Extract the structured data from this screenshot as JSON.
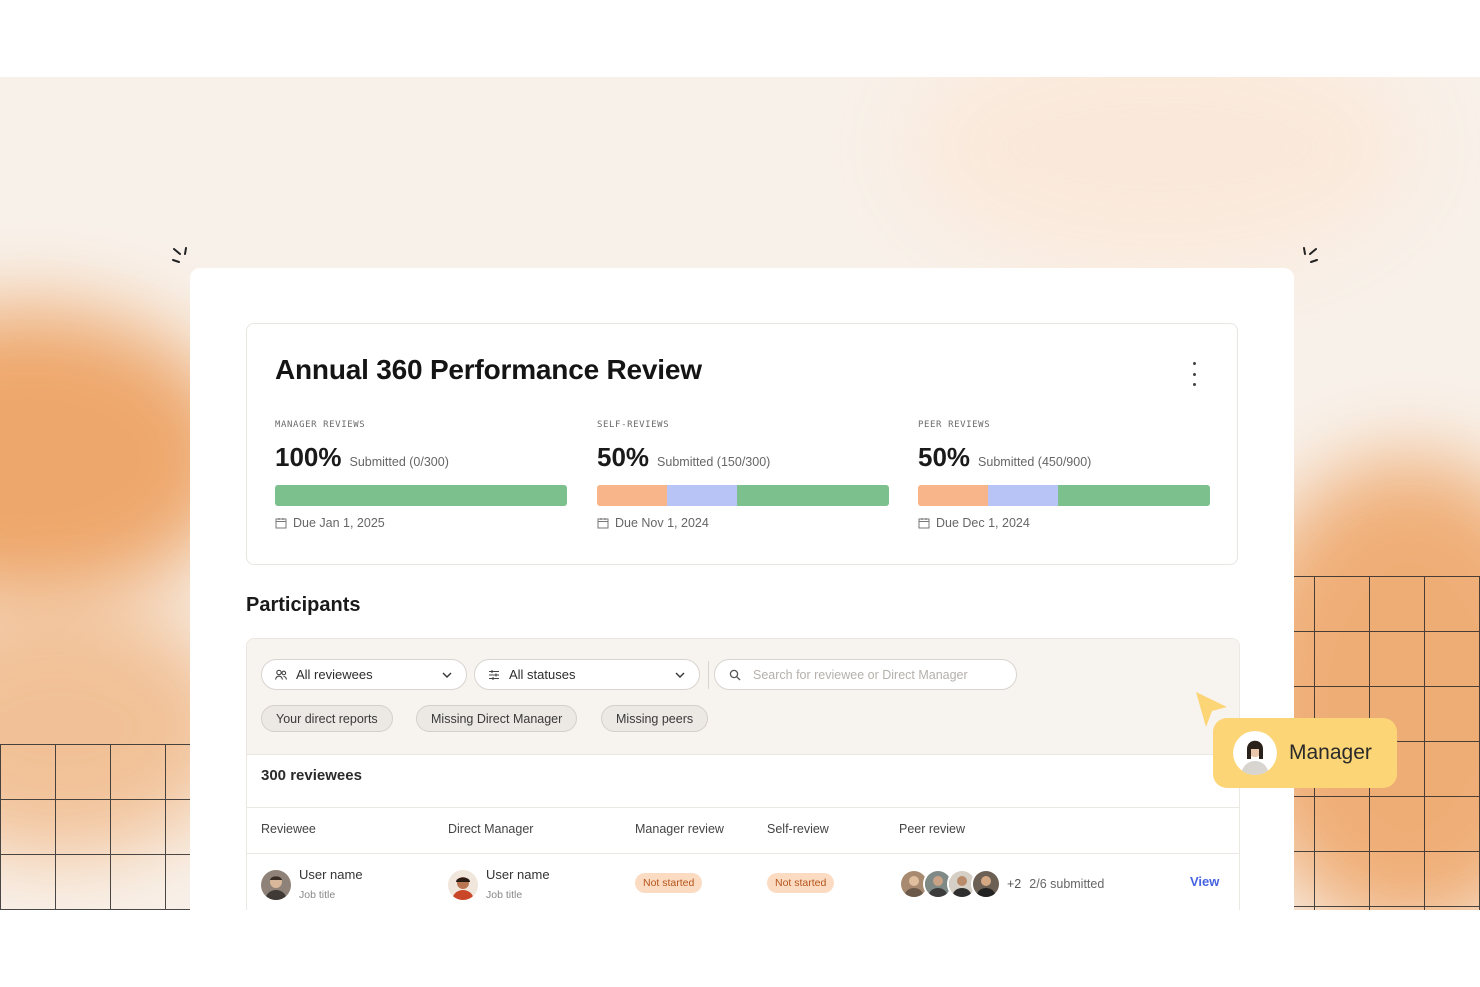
{
  "review": {
    "title": "Annual 360 Performance Review",
    "metrics": [
      {
        "label": "MANAGER REVIEWS",
        "percent": "100%",
        "submitted": "Submitted (0/300)",
        "due": "Due Jan 1, 2025",
        "segments": [
          {
            "share": 1.0,
            "color": "#7cc08d"
          }
        ]
      },
      {
        "label": "SELF-REVIEWS",
        "percent": "50%",
        "submitted": "Submitted (150/300)",
        "due": "Due Nov 1, 2024",
        "segments": [
          {
            "share": 0.24,
            "color": "#f9b58a"
          },
          {
            "share": 0.24,
            "color": "#b9c4f6"
          },
          {
            "share": 0.52,
            "color": "#7cc08d"
          }
        ]
      },
      {
        "label": "PEER REVIEWS",
        "percent": "50%",
        "submitted": "Submitted (450/900)",
        "due": "Due Dec 1, 2024",
        "segments": [
          {
            "share": 0.24,
            "color": "#f9b58a"
          },
          {
            "share": 0.24,
            "color": "#b9c4f6"
          },
          {
            "share": 0.52,
            "color": "#7cc08d"
          }
        ]
      }
    ]
  },
  "participants": {
    "title": "Participants",
    "filters": {
      "reviewees": "All reviewees",
      "statuses": "All statuses",
      "search_placeholder": "Search for reviewee or Direct Manager"
    },
    "chips": [
      "Your direct reports",
      "Missing Direct Manager",
      "Missing peers"
    ],
    "count": "300 reviewees",
    "columns": [
      "Reviewee",
      "Direct Manager",
      "Manager review",
      "Self-review",
      "Peer review"
    ],
    "rows": [
      {
        "reviewee": {
          "name": "User name",
          "title": "Job title"
        },
        "manager": {
          "name": "User name",
          "title": "Job title"
        },
        "manager_review": "Not started",
        "self_review": "Not started",
        "peer_more": "+2",
        "peer_status": "2/6 submitted",
        "action": "View"
      }
    ]
  },
  "tag": {
    "label": "Manager",
    "color": "#fcd576"
  }
}
